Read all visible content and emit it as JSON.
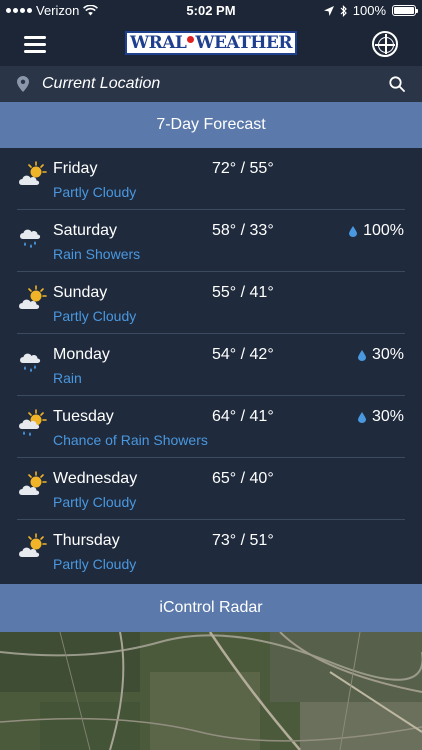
{
  "status_bar": {
    "carrier": "Verizon",
    "time": "5:02 PM",
    "battery": "100%"
  },
  "nav": {
    "logo_text_left": "WRAL",
    "logo_text_right": "WEATHER",
    "menu_icon": "hamburger-menu-icon",
    "radar_icon": "radar-crosshair-icon"
  },
  "location": {
    "label": "Current Location",
    "pin_icon": "location-pin-icon",
    "search_icon": "search-icon"
  },
  "forecast": {
    "title": "7-Day Forecast",
    "days": [
      {
        "day": "Friday",
        "condition": "Partly Cloudy",
        "temps": "72° / 55°",
        "precip": "",
        "icon": "partly-cloudy"
      },
      {
        "day": "Saturday",
        "condition": "Rain Showers",
        "temps": "58° / 33°",
        "precip": "100%",
        "icon": "rain"
      },
      {
        "day": "Sunday",
        "condition": "Partly Cloudy",
        "temps": "55° / 41°",
        "precip": "",
        "icon": "partly-cloudy"
      },
      {
        "day": "Monday",
        "condition": "Rain",
        "temps": "54° / 42°",
        "precip": "30%",
        "icon": "rain"
      },
      {
        "day": "Tuesday",
        "condition": "Chance of Rain Showers",
        "temps": "64° / 41°",
        "precip": "30%",
        "icon": "sun-rain"
      },
      {
        "day": "Wednesday",
        "condition": "Partly Cloudy",
        "temps": "65° / 40°",
        "precip": "",
        "icon": "partly-cloudy"
      },
      {
        "day": "Thursday",
        "condition": "Partly Cloudy",
        "temps": "73° / 51°",
        "precip": "",
        "icon": "partly-cloudy"
      }
    ]
  },
  "radar": {
    "title": "iControl Radar"
  },
  "colors": {
    "background": "#1f2a3c",
    "header_band": "#5b7aab",
    "condition_text": "#4a98e0",
    "sun": "#f0b429"
  }
}
